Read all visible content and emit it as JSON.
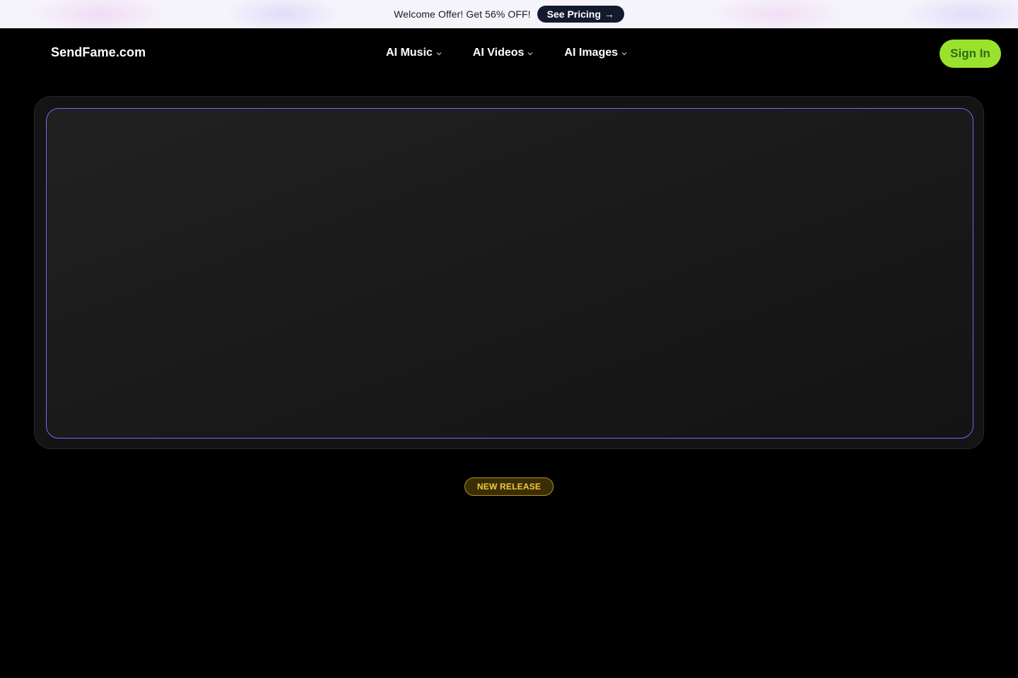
{
  "promo": {
    "text": "Welcome Offer! Get 56% OFF!",
    "button_label": "See Pricing",
    "button_icon": "→"
  },
  "header": {
    "logo": "SendFame.com",
    "nav": [
      {
        "label": "AI Music"
      },
      {
        "label": "AI Videos"
      },
      {
        "label": "AI Images"
      }
    ],
    "sign_in": "Sign In"
  },
  "badge": {
    "label": "NEW RELEASE"
  },
  "colors": {
    "accent_green": "#9be22d",
    "accent_purple": "#8b5cf6",
    "badge_gold": "#f5c93a",
    "background": "#000000"
  }
}
